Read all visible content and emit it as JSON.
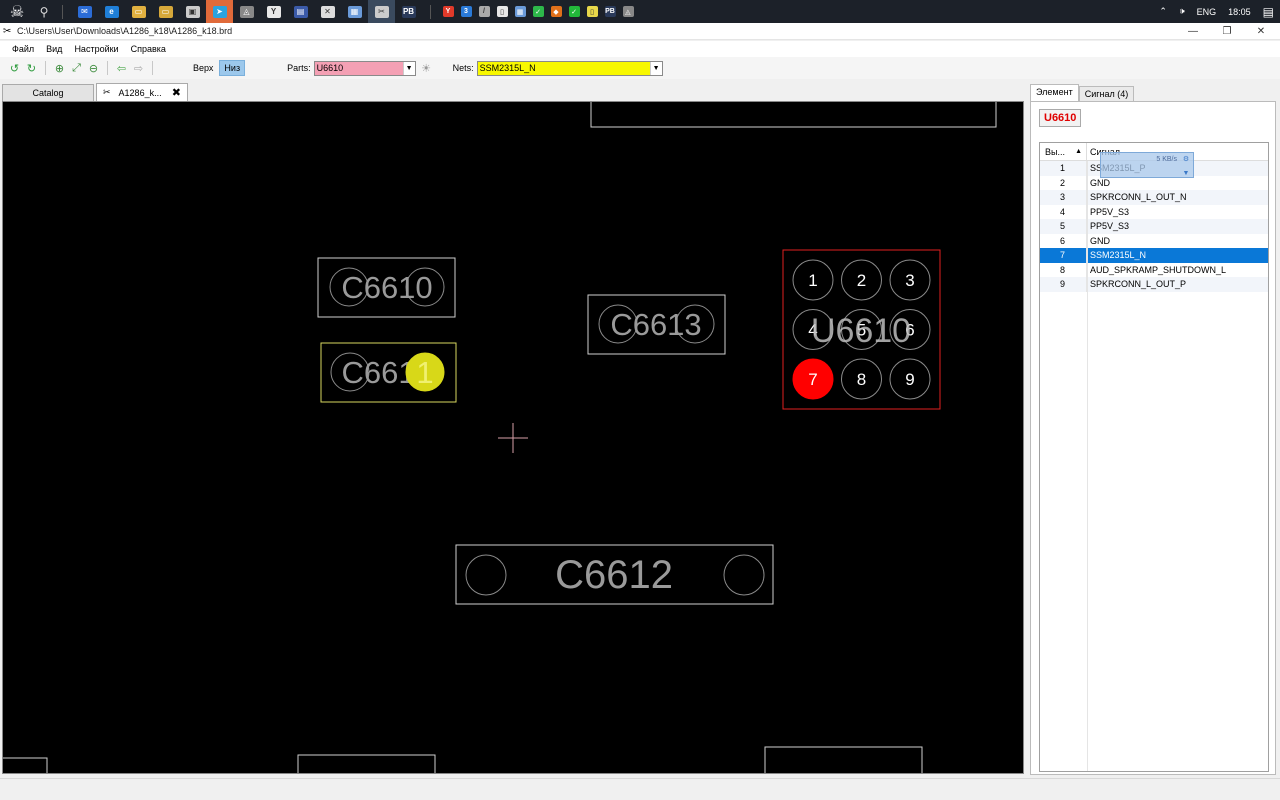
{
  "taskbar": {
    "apps": [
      {
        "name": "mail-icon",
        "color": "#2b6cd6",
        "glyph": "✉",
        "state": ""
      },
      {
        "name": "edge-icon",
        "color": "#1f7fd8",
        "glyph": "e",
        "state": ""
      },
      {
        "name": "folder-icon",
        "color": "#e0b040",
        "glyph": "▭",
        "state": ""
      },
      {
        "name": "folder-icon",
        "color": "#d6a83a",
        "glyph": "▭",
        "state": ""
      },
      {
        "name": "store-icon",
        "color": "#cccccc",
        "glyph": "▣",
        "state": ""
      },
      {
        "name": "telegram-icon",
        "color": "#2aa3e0",
        "glyph": "➤",
        "state": "hot"
      },
      {
        "name": "network-icon",
        "color": "#888888",
        "glyph": "◬",
        "state": ""
      },
      {
        "name": "yandex-browser-icon",
        "color": "#e8e8e8",
        "glyph": "Y",
        "state": ""
      },
      {
        "name": "save-app-icon",
        "color": "#3b5aa8",
        "glyph": "▤",
        "state": ""
      },
      {
        "name": "mail-app-icon",
        "color": "#dddddd",
        "glyph": "✕",
        "state": ""
      },
      {
        "name": "window-app-icon",
        "color": "#6a9ad8",
        "glyph": "▦",
        "state": ""
      },
      {
        "name": "boardviewer-icon",
        "color": "#cccccc",
        "glyph": "✂",
        "state": "active"
      },
      {
        "name": "pb-app-icon",
        "color": "#2a3a5a",
        "glyph": "PB",
        "state": ""
      }
    ],
    "tray": [
      {
        "name": "yandex-tray-icon",
        "color": "#e23a2a",
        "glyph": "Y"
      },
      {
        "name": "shield-tray-icon",
        "color": "#2a7ad8",
        "glyph": "3"
      },
      {
        "name": "pen-tray-icon",
        "color": "#aaaaaa",
        "glyph": "/"
      },
      {
        "name": "doc-tray-icon",
        "color": "#e8e8e8",
        "glyph": "▯"
      },
      {
        "name": "window-tray-icon",
        "color": "#6a9ad8",
        "glyph": "▦"
      },
      {
        "name": "check-tray-icon",
        "color": "#2db84a",
        "glyph": "✓"
      },
      {
        "name": "fox-tray-icon",
        "color": "#e0701a",
        "glyph": "◆"
      },
      {
        "name": "check-tray-icon",
        "color": "#22b83a",
        "glyph": "✓"
      },
      {
        "name": "file-tray-icon",
        "color": "#e8d84a",
        "glyph": "▯"
      },
      {
        "name": "pb-tray-icon",
        "color": "#2a3a5a",
        "glyph": "PB"
      },
      {
        "name": "network-tray-icon",
        "color": "#888888",
        "glyph": "◬"
      }
    ],
    "lang": "ENG",
    "time": "18:05"
  },
  "window": {
    "title": "C:\\Users\\User\\Downloads\\A1286_k18\\A1286_k18.brd"
  },
  "menu": [
    "Файл",
    "Вид",
    "Настройки",
    "Справка"
  ],
  "toolbar": {
    "side_top": "Верх",
    "side_bottom": "Низ",
    "parts_label": "Parts:",
    "parts_value": "U6610",
    "nets_label": "Nets:",
    "nets_value": "SSM2315L_N",
    "parts_bg": "#f4a0b4",
    "nets_bg": "#f8f800"
  },
  "tabs": {
    "catalog": "Catalog",
    "board": "A1286_k..."
  },
  "board": {
    "components": [
      {
        "ref": "C6610",
        "highlight": false
      },
      {
        "ref": "C6611",
        "highlight": true
      },
      {
        "ref": "C6613",
        "highlight": false
      },
      {
        "ref": "C6612",
        "highlight": false
      },
      {
        "ref": "U6610",
        "highlight": true
      }
    ],
    "selected_pin": "1",
    "u6610_pins": [
      "1",
      "2",
      "3",
      "4",
      "5",
      "6",
      "7",
      "8",
      "9"
    ],
    "u6610_active_pin": "7"
  },
  "panel": {
    "tab_element": "Элемент",
    "tab_signal": "Сигнал (4)",
    "part": "U6610",
    "col_pin": "Вы...",
    "col_signal": "Сигнал",
    "netmon_text": "5 KB/s",
    "pins": [
      {
        "pin": "1",
        "signal": "SSM2315L_P"
      },
      {
        "pin": "2",
        "signal": "GND"
      },
      {
        "pin": "3",
        "signal": "SPKRCONN_L_OUT_N"
      },
      {
        "pin": "4",
        "signal": "PP5V_S3"
      },
      {
        "pin": "5",
        "signal": "PP5V_S3"
      },
      {
        "pin": "6",
        "signal": "GND"
      },
      {
        "pin": "7",
        "signal": "SSM2315L_N"
      },
      {
        "pin": "8",
        "signal": "AUD_SPKRAMP_SHUTDOWN_L"
      },
      {
        "pin": "9",
        "signal": "SPKRCONN_L_OUT_P"
      }
    ],
    "selected_pin": "7"
  }
}
